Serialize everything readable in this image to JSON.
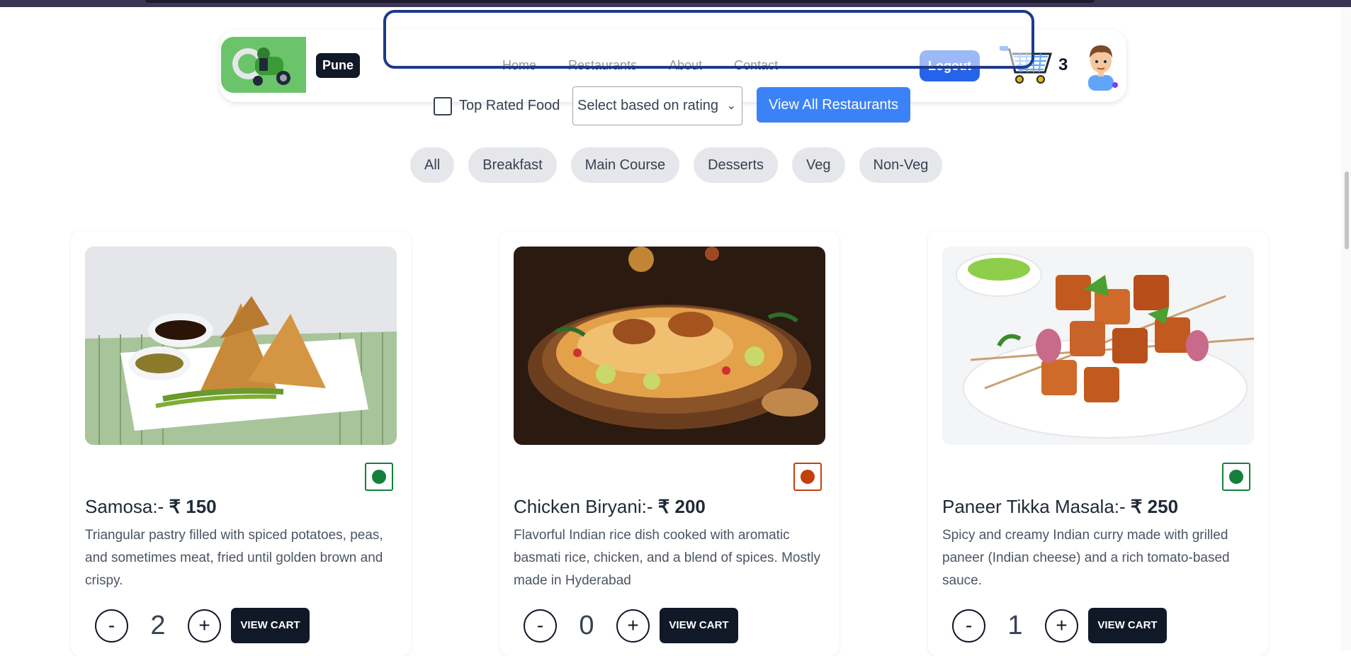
{
  "header": {
    "city": "Pune",
    "nav": [
      "Home",
      "Restaurants",
      "About",
      "Contact"
    ],
    "logout_label": "Logout",
    "cart_count": "3"
  },
  "filters": {
    "top_rated_label": "Top Rated Food",
    "top_rated_checked": false,
    "rating_select_value": "Select based on rating",
    "view_all_label": "View All Restaurants"
  },
  "categories": [
    "All",
    "Breakfast",
    "Main Course",
    "Desserts",
    "Veg",
    "Non-Veg"
  ],
  "items": [
    {
      "name": "Samosa:-",
      "price": "₹ 150",
      "description": "Triangular pastry filled with spiced potatoes, peas, and sometimes meat, fried until golden brown and crispy.",
      "diet": "veg",
      "diet_color": "#15803d",
      "quantity": "2",
      "minus": "-",
      "plus": "+",
      "cart_label": "VIEW CART",
      "image_icon": "samosa-image"
    },
    {
      "name": "Chicken Biryani:-",
      "price": "₹ 200",
      "description": "Flavorful Indian rice dish cooked with aromatic basmati rice, chicken, and a blend of spices. Mostly made in Hyderabad",
      "diet": "non-veg",
      "diet_color": "#c2410c",
      "quantity": "0",
      "minus": "-",
      "plus": "+",
      "cart_label": "VIEW CART",
      "image_icon": "biryani-image"
    },
    {
      "name": "Paneer Tikka Masala:-",
      "price": "₹ 250",
      "description": "Spicy and creamy Indian curry made with grilled paneer (Indian cheese) and a rich tomato-based sauce.",
      "diet": "veg",
      "diet_color": "#15803d",
      "quantity": "1",
      "minus": "-",
      "plus": "+",
      "cart_label": "VIEW CART",
      "image_icon": "paneer-tikka-image"
    }
  ],
  "colors": {
    "primary": "#2563eb",
    "view_all": "#3b82f6",
    "dark": "#111827",
    "logo_green": "#6cc46a"
  }
}
